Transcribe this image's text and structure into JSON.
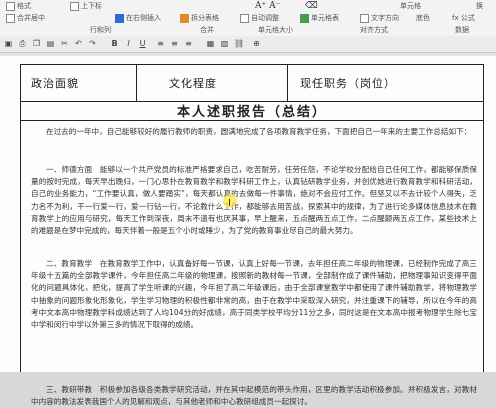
{
  "ribbon": {
    "row1": [
      {
        "icon": "format-painter-icon",
        "label": "格式"
      },
      {
        "icon": "superscript-icon",
        "label": "上下标"
      },
      {
        "icon": "eraser-icon",
        "label": ""
      },
      {
        "icon": "font-size-icon",
        "label": ""
      }
    ],
    "row2": [
      {
        "icon": "merge-center-icon",
        "label": "合并居中"
      },
      {
        "icon": "insert-icon",
        "label": "在右侧插入"
      },
      {
        "icon": "split-icon",
        "label": "拆分表格"
      },
      {
        "icon": "autofit-icon",
        "label": "自动调整"
      },
      {
        "icon": "shading-icon",
        "label": "单元格表"
      },
      {
        "icon": "text-dir-icon",
        "label": "文字方向"
      },
      {
        "icon": "formula-icon",
        "label": "fx 公式"
      }
    ],
    "groups": [
      "行和列",
      "合并",
      "单元格大小",
      "对齐方式",
      "数据"
    ],
    "extra": "单元格",
    "extra2": "底色",
    "extra3": "换"
  },
  "document": {
    "header": {
      "col1": "政治面貌",
      "col2": "文化程度",
      "col3": "现任职务（岗位）"
    },
    "title": "本人述职报告（总结）",
    "paragraphs": [
      "在过去的一年中，自己能够较好的履行教师的职责，圆满地完成了各项教育教学任务，下面把自己一年来的主要工作总结如下：",
      "一、师德方面　能够以一个共产党员的标准严格要求自己，吃苦耐劳，任劳任怨，不论学校分配给自己任何工作，都能够保质保量的按时完成，每天早出晚归，一门心思扑在教育教学和教学科研工作上，认真钻研教学业务，并创优她进行教育教学和科研活动，自己的业务能力，“工作要认真，做人要踏实”，每天都认真的去做每一件事情，绝对不会应付工作。但坚又以不去计较个人得失，乏力名不为利，干一行爱一行，爱一行钻一行，不论教什么工作，都能够去用苦战，探索其中的规律，为了进行论多媒体信息技术在教育教学上的应用与研究，每天工作到深夜，周末不遗有也厌其事，早上醒来，五点醒两五点工作，二点醒颠两五点工作，某些技术上的难题是在梦中完成的，每天伴着一般是五个小时或睡少，为了党的教育事业尽自己的最大努力。",
      "二、教育教学　在教育教学工作中，认真备好每一节课，认真上好每一节课，去年担任高二年级的物理课，已经制作完成了高三年级十五篇的全部教学课件，今年担任高二年级的物理课，按照新的教材每一节课，全部制作成了课件辅助，把物理事知识变得平面化的问题具体化，把化，提高了学生听课的兴趣，今年担了高二年级课后，由于全部课堂教学中都使用了课件辅助教学，将物理教学中抽象的问题形象化形象化，学生学习物理的积极性都非常的高，由于在教学中采取深入研究，并注重课下的辅导，所以在今年的高考中文本高中物理教学科成绩达到了人均104分的好成绩，高于同类学校平均分11分之多，同时这是在文本高中报考物理学生除七宝中学和闵行中学以外第三多的情况下取得的成绩。",
      "三、教研带教　积极参加各级各类教学研究活动，并在其中起模范的带头作用，区里的教学活动积极参加。并积极发言，对教材中内容的教法发表我国个人的见解和观点，与其他老师和中心教研组成员一起探讨。"
    ]
  },
  "colors": {
    "ribbon_bg": "#f3f3f3",
    "page_bg": "#fdfdfb",
    "border": "#222222",
    "cursor_highlight": "#ffe63c"
  }
}
